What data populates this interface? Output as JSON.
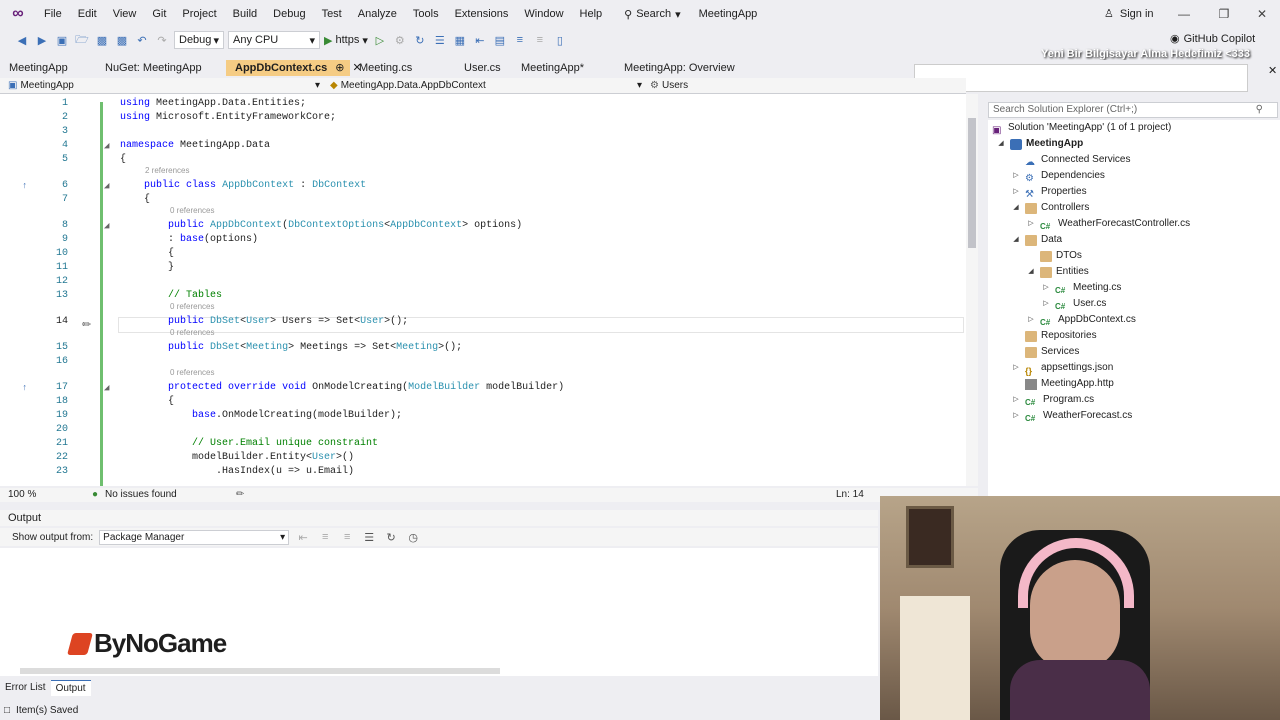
{
  "menu": {
    "items": [
      "File",
      "Edit",
      "View",
      "Git",
      "Project",
      "Build",
      "Debug",
      "Test",
      "Analyze",
      "Tools",
      "Extensions",
      "Window",
      "Help"
    ],
    "search_label": "Search",
    "solution_name": "MeetingApp",
    "sign_in": "Sign in"
  },
  "toolbar": {
    "config": "Debug",
    "platform": "Any CPU",
    "run_target": "https",
    "copilot": "GitHub Copilot"
  },
  "overlay_banner": "Yeni Bir Bilgisayar Alma Hedefimiz <333",
  "tabs": [
    {
      "label": "MeetingApp"
    },
    {
      "label": "NuGet: MeetingApp"
    },
    {
      "label": "AppDbContext.cs",
      "active": true
    },
    {
      "label": "Meeting.cs"
    },
    {
      "label": "User.cs"
    },
    {
      "label": "MeetingApp*"
    },
    {
      "label": "MeetingApp: Overview"
    }
  ],
  "navbar": {
    "project": "MeetingApp",
    "type": "MeetingApp.Data.AppDbContext",
    "member": "Users"
  },
  "editor": {
    "lines": [
      {
        "n": "1",
        "code": "using MeetingApp.Data.Entities;"
      },
      {
        "n": "2",
        "code": "using Microsoft.EntityFrameworkCore;"
      },
      {
        "n": "3",
        "code": ""
      },
      {
        "n": "4",
        "code": "namespace MeetingApp.Data"
      },
      {
        "n": "5",
        "code": "{"
      },
      {
        "n": "6",
        "code": "    public class AppDbContext : DbContext",
        "refs": "2 references"
      },
      {
        "n": "7",
        "code": "    {"
      },
      {
        "n": "8",
        "code": "        public AppDbContext(DbContextOptions<AppDbContext> options)",
        "refs": "0 references"
      },
      {
        "n": "9",
        "code": "        : base(options)"
      },
      {
        "n": "10",
        "code": "        {"
      },
      {
        "n": "11",
        "code": "        }"
      },
      {
        "n": "12",
        "code": ""
      },
      {
        "n": "13",
        "code": "        // Tables"
      },
      {
        "n": "14",
        "code": "        public DbSet<User> Users => Set<User>();",
        "refs": "0 references"
      },
      {
        "n": "15",
        "code": "        public DbSet<Meeting> Meetings => Set<Meeting>();",
        "refs": "0 references"
      },
      {
        "n": "16",
        "code": ""
      },
      {
        "n": "17",
        "code": "        protected override void OnModelCreating(ModelBuilder modelBuilder)",
        "refs": "0 references"
      },
      {
        "n": "18",
        "code": "        {"
      },
      {
        "n": "19",
        "code": "            base.OnModelCreating(modelBuilder);"
      },
      {
        "n": "20",
        "code": ""
      },
      {
        "n": "21",
        "code": "            // User.Email unique constraint"
      },
      {
        "n": "22",
        "code": "            modelBuilder.Entity<User>()"
      },
      {
        "n": "23",
        "code": "                .HasIndex(u => u.Email)"
      }
    ],
    "current_line": "14"
  },
  "editor_status": {
    "zoom": "100 %",
    "issues": "No issues found",
    "position": "Ln: 14"
  },
  "solution_explorer": {
    "search_placeholder": "Search Solution Explorer (Ctrl+;)",
    "solution": "Solution 'MeetingApp' (1 of 1 project)",
    "items": [
      {
        "label": "MeetingApp",
        "icon": "project-icon",
        "depth": 1,
        "expander": "expanded",
        "bold": true
      },
      {
        "label": "Connected Services",
        "icon": "connected-services-icon",
        "depth": 2,
        "expander": "none"
      },
      {
        "label": "Dependencies",
        "icon": "dependencies-icon",
        "depth": 2,
        "expander": "collapsed"
      },
      {
        "label": "Properties",
        "icon": "properties-icon",
        "depth": 2,
        "expander": "collapsed"
      },
      {
        "label": "Controllers",
        "icon": "folder-icon",
        "depth": 2,
        "expander": "expanded"
      },
      {
        "label": "WeatherForecastController.cs",
        "icon": "csharp-file-icon",
        "depth": 3,
        "expander": "collapsed"
      },
      {
        "label": "Data",
        "icon": "folder-icon",
        "depth": 2,
        "expander": "expanded"
      },
      {
        "label": "DTOs",
        "icon": "folder-icon",
        "depth": 3,
        "expander": "none"
      },
      {
        "label": "Entities",
        "icon": "folder-icon",
        "depth": 3,
        "expander": "expanded"
      },
      {
        "label": "Meeting.cs",
        "icon": "csharp-file-icon",
        "depth": 4,
        "expander": "collapsed"
      },
      {
        "label": "User.cs",
        "icon": "csharp-file-icon",
        "depth": 4,
        "expander": "collapsed"
      },
      {
        "label": "AppDbContext.cs",
        "icon": "csharp-file-icon",
        "depth": 3,
        "expander": "collapsed"
      },
      {
        "label": "Repositories",
        "icon": "folder-icon",
        "depth": 2,
        "expander": "none"
      },
      {
        "label": "Services",
        "icon": "folder-icon",
        "depth": 2,
        "expander": "none"
      },
      {
        "label": "appsettings.json",
        "icon": "json-file-icon",
        "depth": 2,
        "expander": "collapsed"
      },
      {
        "label": "MeetingApp.http",
        "icon": "http-file-icon",
        "depth": 2,
        "expander": "none"
      },
      {
        "label": "Program.cs",
        "icon": "csharp-file-icon",
        "depth": 2,
        "expander": "collapsed"
      },
      {
        "label": "WeatherForecast.cs",
        "icon": "csharp-file-icon",
        "depth": 2,
        "expander": "collapsed"
      }
    ]
  },
  "output": {
    "title": "Output",
    "show_from_label": "Show output from:",
    "source": "Package Manager"
  },
  "brand": "ByNoGame",
  "bottom_tabs": [
    {
      "label": "Error List"
    },
    {
      "label": "Output",
      "active": true
    }
  ],
  "status": "Item(s) Saved",
  "colors": {
    "accent": "#68217a",
    "active_tab": "#f5cc84",
    "keyword": "#0000ff",
    "type": "#2b91af",
    "comment": "#008000",
    "change_bar": "#6fbf6f"
  }
}
